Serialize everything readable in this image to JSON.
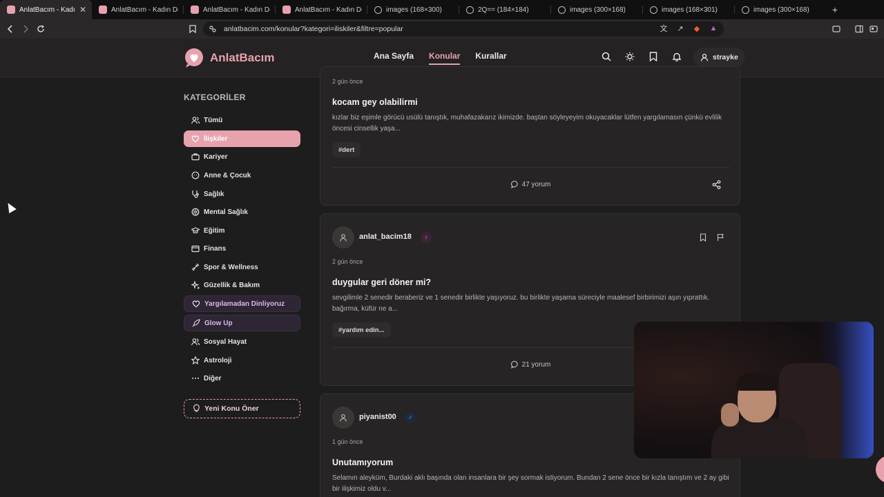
{
  "browser": {
    "tabs": [
      {
        "title": "AnlatBacım - Kadın Destek",
        "active": true,
        "favicon": "pink"
      },
      {
        "title": "AnlatBacım - Kadın Destek",
        "active": false,
        "favicon": "pink"
      },
      {
        "title": "AnlatBacım - Kadın Destek",
        "active": false,
        "favicon": "pink"
      },
      {
        "title": "AnlatBacım - Kadın Destek",
        "active": false,
        "favicon": "pink"
      },
      {
        "title": "images (168×300)",
        "active": false,
        "favicon": "globe"
      },
      {
        "title": "2Q== (184×184)",
        "active": false,
        "favicon": "globe"
      },
      {
        "title": "images (300×168)",
        "active": false,
        "favicon": "globe"
      },
      {
        "title": "images (168×301)",
        "active": false,
        "favicon": "globe"
      },
      {
        "title": "images (300×168)",
        "active": false,
        "favicon": "globe"
      }
    ],
    "new_tab": "+",
    "url": "anlatbacim.com/konular?kategori=iliskiler&filtre=popular"
  },
  "site": {
    "logo_text": "AnlatBacım",
    "nav": [
      {
        "label": "Ana Sayfa",
        "active": false
      },
      {
        "label": "Konular",
        "active": true
      },
      {
        "label": "Kurallar",
        "active": false
      }
    ],
    "username": "strayke",
    "accent_color": "#e7a2ae"
  },
  "sidebar": {
    "title": "KATEGORİLER",
    "items": [
      {
        "label": "Tümü",
        "icon": "users-icon",
        "style": "normal"
      },
      {
        "label": "İlişkiler",
        "icon": "heart-icon",
        "style": "active"
      },
      {
        "label": "Kariyer",
        "icon": "briefcase-icon",
        "style": "normal"
      },
      {
        "label": "Anne & Çocuk",
        "icon": "baby-icon",
        "style": "normal"
      },
      {
        "label": "Sağlık",
        "icon": "stethoscope-icon",
        "style": "normal"
      },
      {
        "label": "Mental Sağlık",
        "icon": "brain-icon",
        "style": "normal"
      },
      {
        "label": "Eğitim",
        "icon": "graduation-cap-icon",
        "style": "normal"
      },
      {
        "label": "Finans",
        "icon": "wallet-icon",
        "style": "normal"
      },
      {
        "label": "Spor & Wellness",
        "icon": "dumbbell-icon",
        "style": "normal"
      },
      {
        "label": "Güzellik & Bakım",
        "icon": "sparkle-icon",
        "style": "normal"
      },
      {
        "label": "Yargılamadan Dinliyoruz",
        "icon": "heart-handshake-icon",
        "style": "special"
      },
      {
        "label": "Glow Up",
        "icon": "rocket-icon",
        "style": "special"
      },
      {
        "label": "Sosyal Hayat",
        "icon": "people-icon",
        "style": "normal"
      },
      {
        "label": "Astroloji",
        "icon": "star-icon",
        "style": "normal"
      },
      {
        "label": "Diğer",
        "icon": "more-icon",
        "style": "normal"
      }
    ],
    "suggest_label": "Yeni Konu Öner"
  },
  "posts": [
    {
      "time": "2 gün önce",
      "title": "kocam gey olabilirmi",
      "excerpt": "kızlar biz eşimle görücü usülü tanıştık, muhafazakarız ikimizde. baştan söyleyeyim okuyacaklar lütfen yargılamasın çünkü evlilik öncesi cinsellik yaşa...",
      "tag": "#dert",
      "comments": "47 yorum"
    },
    {
      "user": "anlat_bacim18",
      "gender": "♀",
      "gender_color": "#d066b8",
      "time": "2 gün önce",
      "title": "duygular geri döner mi?",
      "excerpt": "sevgilimle 2 senedir beraberiz ve 1 senedir birlikte yaşıyoruz. bu birlikte yaşama süreciyle maalesef birbirimizi aşın yıprattık. bağırma, küfür ne a...",
      "tag": "#yardım edin...",
      "comments": "21 yorum"
    },
    {
      "user": "piyanist00",
      "gender": "♂",
      "gender_color": "#5b8de0",
      "time": "1 gün önce",
      "title": "Unutamıyorum",
      "excerpt": "Selamın aleyküm, Burdaki aklı başında olan insanlara bir şey sormak istiyorum. Bundan 2 sene önce bir kızla tanıştım ve 2 ay gibi bir ilişkimiz oldu v..."
    }
  ]
}
